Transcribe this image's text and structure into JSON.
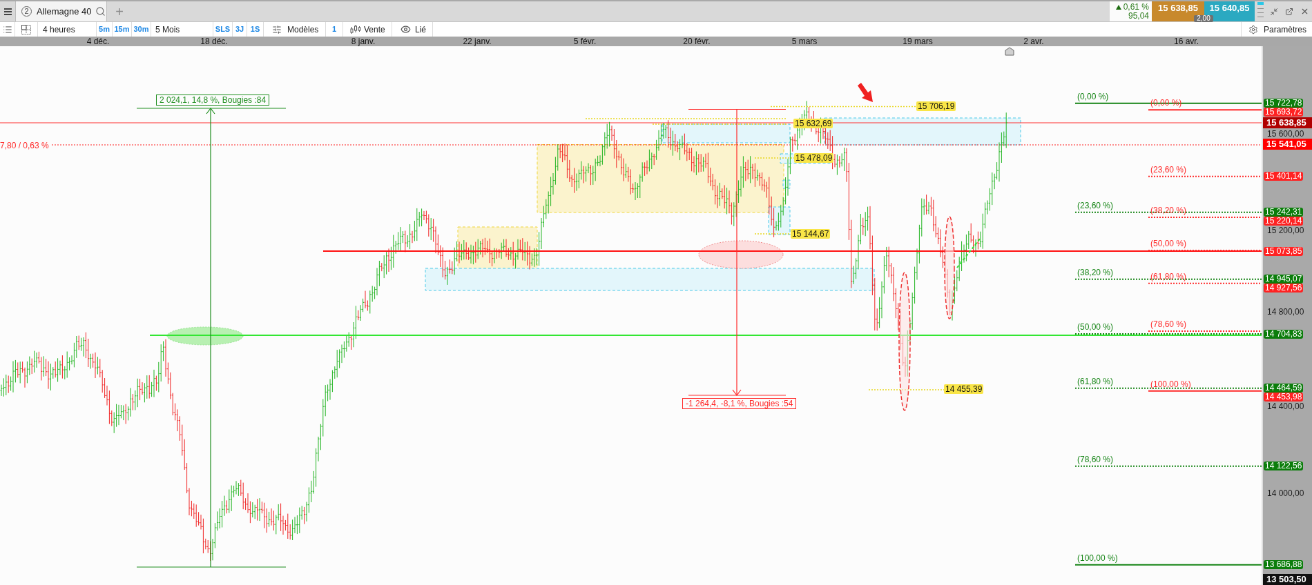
{
  "tab_bar": {
    "tabs": [
      {
        "number": "2",
        "label": "Allemagne 40",
        "selected": true
      }
    ],
    "new_tab": "+"
  },
  "quote": {
    "rising": true,
    "change_percent": "0,61 %",
    "change_points": "95,04",
    "bid": "15 638,85",
    "ask": "15 640,85",
    "spread": "2,00"
  },
  "toolbar": {
    "interval": "4 heures",
    "interval_presets": [
      "5m",
      "15m",
      "30m"
    ],
    "period": "5 Mois",
    "period_presets": [
      "SLS",
      "3J",
      "1S"
    ],
    "templates": "Modèles",
    "template_count": "1",
    "chart_type": "Vente",
    "link": "Lié",
    "settings": "Paramètres"
  },
  "date_axis": [
    "4 déc.",
    "18 déc.",
    "8 janv.",
    "22 janv.",
    "5 févr.",
    "20 févr.",
    "5 mars",
    "19 mars",
    "2 avr.",
    "16 avr."
  ],
  "chart": {
    "line_label": "7,80 / 0,63 %",
    "measures": [
      {
        "label": "2 024,1, 14,8 %, Bougies :84",
        "color": "#1e8e1e"
      },
      {
        "label": "-1 264,4, -8,1 %, Bougies :54",
        "color": "#ff2a2a"
      }
    ],
    "price_tags": [
      "15 706,19",
      "15 632,69",
      "15 478,09",
      "15 144,67",
      "14 455,39"
    ],
    "fibonacci": [
      {
        "color": "#168516",
        "levels": [
          "(0,00 %)",
          "(23,60 %)",
          "(38,20 %)",
          "(50,00 %)",
          "(61,80 %)",
          "(78,60 %)",
          "(100,00 %)"
        ]
      },
      {
        "color": "#ff2a2a",
        "levels": [
          "(0,00 %)",
          "(23,60 %)",
          "(38,20 %)",
          "(50,00 %)",
          "(61,80 %)",
          "(78,60 %)",
          "(100,00 %)"
        ]
      }
    ]
  },
  "price_axis": [
    {
      "kind": "level",
      "label": "15 722,78",
      "color": "#0b7d0b"
    },
    {
      "kind": "level",
      "label": "15 693,72",
      "color": "#ff2222"
    },
    {
      "kind": "quote",
      "label": "15 638,85",
      "color": "#b00000"
    },
    {
      "kind": "tick",
      "label": "15 600,00"
    },
    {
      "kind": "quote",
      "label": "15 541,05",
      "color": "#ff0000"
    },
    {
      "kind": "level",
      "label": "15 401,14",
      "color": "#ff2222"
    },
    {
      "kind": "level",
      "label": "15 242,31",
      "color": "#0b7d0b"
    },
    {
      "kind": "level",
      "label": "15 220,14",
      "color": "#ff2222"
    },
    {
      "kind": "tick",
      "label": "15 200,00"
    },
    {
      "kind": "level",
      "label": "15 073,85",
      "color": "#ff2222"
    },
    {
      "kind": "level",
      "label": "14 945,07",
      "color": "#0b7d0b"
    },
    {
      "kind": "level",
      "label": "14 927,56",
      "color": "#ff2222"
    },
    {
      "kind": "tick",
      "label": "14 800,00"
    },
    {
      "kind": "level",
      "label": "14 704,83",
      "color": "#0b7d0b"
    },
    {
      "kind": "level",
      "label": "14 464,59",
      "color": "#0b7d0b"
    },
    {
      "kind": "level",
      "label": "14 453,98",
      "color": "#ff2222"
    },
    {
      "kind": "tick",
      "label": "14 400,00"
    },
    {
      "kind": "level",
      "label": "14 122,56",
      "color": "#0b7d0b"
    },
    {
      "kind": "tick",
      "label": "14 000,00"
    },
    {
      "kind": "level",
      "label": "13 686,88",
      "color": "#0b7d0b"
    },
    {
      "kind": "quote",
      "label": "13 503,50",
      "color": "#111111"
    }
  ]
}
